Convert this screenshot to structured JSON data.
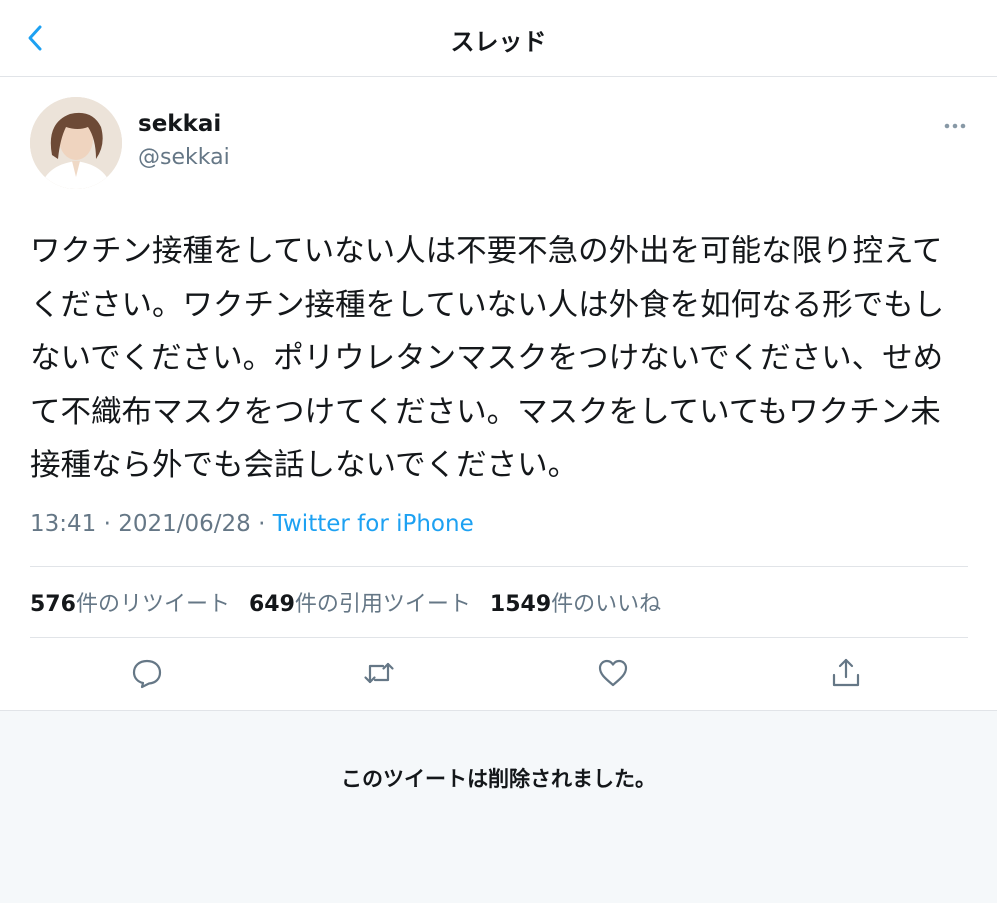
{
  "header": {
    "title": "スレッド",
    "back_icon": "chevron-left-icon"
  },
  "author": {
    "display_name": "sekkai",
    "handle": "@sekkai"
  },
  "tweet": {
    "text": "ワクチン接種をしていない人は不要不急の外出を可能な限り控えてください。ワクチン接種をしていない人は外食を如何なる形でもしないでください。ポリウレタンマスクをつけないでください、せめて不織布マスクをつけてください。マスクをしていてもワクチン未接種なら外でも会話しないでください。",
    "time": "13:41",
    "date": "2021/06/28",
    "separator": "·",
    "source": "Twitter for iPhone"
  },
  "stats": {
    "retweets_count": "576",
    "retweets_label": "件のリツイート",
    "quotes_count": "649",
    "quotes_label": "件の引用ツイート",
    "likes_count": "1549",
    "likes_label": "件のいいね"
  },
  "actions": {
    "reply_icon": "reply-icon",
    "retweet_icon": "retweet-icon",
    "like_icon": "heart-icon",
    "share_icon": "share-icon"
  },
  "deleted_notice": "このツイートは削除されました。",
  "colors": {
    "accent": "#1da1f2",
    "secondary_text": "#657786",
    "primary_text": "#14171a",
    "divider": "#e1e4e8",
    "deleted_bg": "#f5f8fa"
  }
}
